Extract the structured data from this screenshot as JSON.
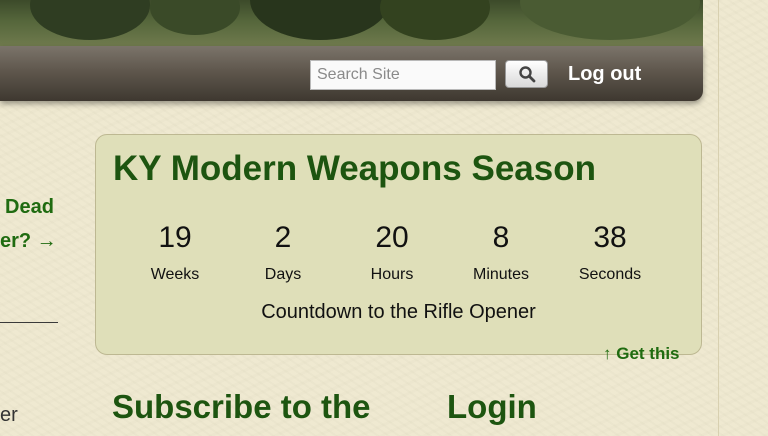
{
  "header": {
    "search_placeholder": "Search Site",
    "search_icon": "magnifier-icon",
    "logout_label": "Log out"
  },
  "sidebar": {
    "link_line1": "Dead",
    "link_line2": "er? →",
    "text_fragment": "er"
  },
  "countdown": {
    "title": "KY Modern Weapons Season",
    "units": [
      {
        "value": "19",
        "label": "Weeks"
      },
      {
        "value": "2",
        "label": "Days"
      },
      {
        "value": "20",
        "label": "Hours"
      },
      {
        "value": "8",
        "label": "Minutes"
      },
      {
        "value": "38",
        "label": "Seconds"
      }
    ],
    "caption": "Countdown to the Rifle Opener",
    "get_this": "↑ Get this"
  },
  "footer_headings": {
    "subscribe": "Subscribe to the",
    "login": "Login"
  },
  "colors": {
    "accent_green": "#1d5510",
    "link_green": "#1f6b10",
    "widget_bg": "#dfdfb9",
    "page_bg": "#efe9cf"
  }
}
